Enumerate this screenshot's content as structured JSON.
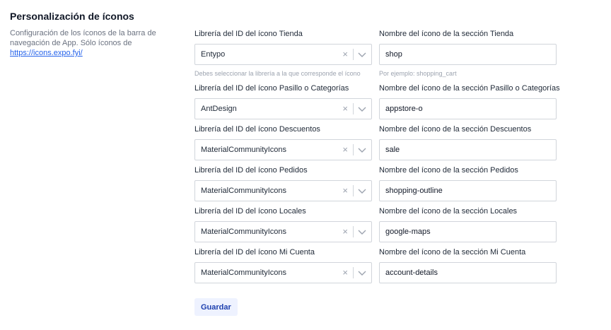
{
  "section": {
    "title": "Personalización de íconos",
    "description": "Configuración de los íconos de la barra de navegación de App. Sólo íconos de",
    "link": "https://icons.expo.fyi/"
  },
  "rows": [
    {
      "lib_label": "Librería del ID del ícono Tienda",
      "lib_value": "Entypo",
      "lib_hint": "Debes seleccionar la librería a la que corresponde el ícono",
      "name_label": "Nombre del ícono de la sección Tienda",
      "name_value": "shop",
      "name_hint": "Por ejemplo: shopping_cart"
    },
    {
      "lib_label": "Librería del ID del ícono Pasillo o Categorías",
      "lib_value": "AntDesign",
      "name_label": "Nombre del ícono de la sección Pasillo o Categorías",
      "name_value": "appstore-o"
    },
    {
      "lib_label": "Librería del ID del ícono Descuentos",
      "lib_value": "MaterialCommunityIcons",
      "name_label": "Nombre del ícono de la sección Descuentos",
      "name_value": "sale"
    },
    {
      "lib_label": "Librería del ID del ícono Pedidos",
      "lib_value": "MaterialCommunityIcons",
      "name_label": "Nombre del ícono de la sección Pedidos",
      "name_value": "shopping-outline"
    },
    {
      "lib_label": "Librería del ID del ícono Locales",
      "lib_value": "MaterialCommunityIcons",
      "name_label": "Nombre del ícono de la sección Locales",
      "name_value": "google-maps"
    },
    {
      "lib_label": "Librería del ID del ícono Mi Cuenta",
      "lib_value": "MaterialCommunityIcons",
      "name_label": "Nombre del ícono de la sección Mi Cuenta",
      "name_value": "account-details"
    }
  ],
  "icons": {
    "clear": "×",
    "chevron": "chevron-down-icon"
  },
  "actions": {
    "save_label": "Guardar"
  },
  "colors": {
    "link": "#2563eb",
    "button_bg": "#eef2ff",
    "button_text": "#1e40af"
  }
}
